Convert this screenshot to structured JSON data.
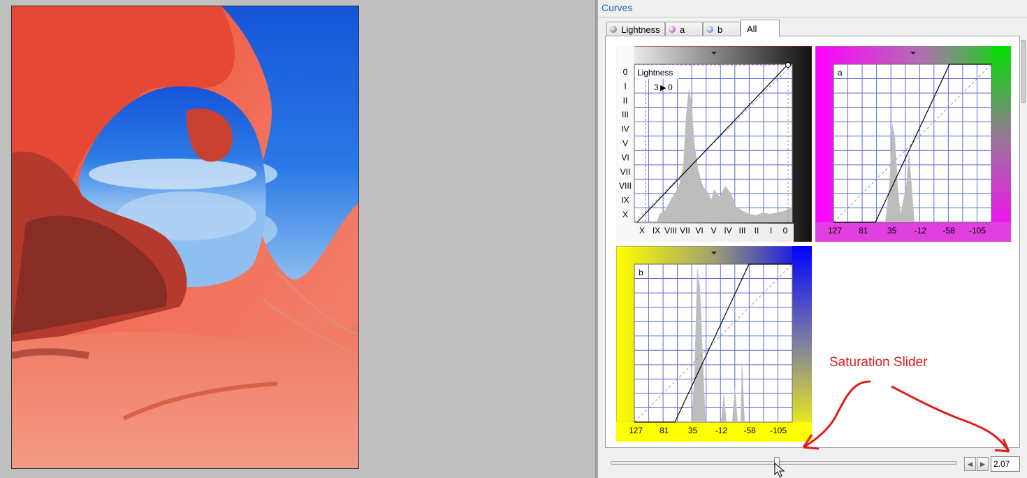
{
  "panel": {
    "title": "Curves"
  },
  "tabs": [
    {
      "label": "Lightness",
      "dot": "#555555"
    },
    {
      "label": "a",
      "dot": "#a030a0"
    },
    {
      "label": "b",
      "dot": "#3070c0"
    },
    {
      "label": "All",
      "dot": ""
    }
  ],
  "lightness_curve": {
    "label": "Lightness",
    "readout_in": "3",
    "readout_arrow": "▶",
    "readout_out": "0",
    "y_axis_ticks": [
      "0",
      "I",
      "II",
      "III",
      "IV",
      "V",
      "VI",
      "VII",
      "VIII",
      "IX",
      "X"
    ],
    "x_axis_ticks": [
      "X",
      "IX",
      "VIII",
      "VII",
      "VI",
      "V",
      "IV",
      "III",
      "II",
      "I",
      "0"
    ]
  },
  "a_curve": {
    "label": "a",
    "x_axis_ticks": [
      "127",
      "81",
      "35",
      "-12",
      "-58",
      "-105"
    ]
  },
  "b_curve": {
    "label": "b",
    "x_axis_ticks": [
      "127",
      "81",
      "35",
      "-12",
      "-58",
      "-105"
    ]
  },
  "saturation": {
    "value": "2.07",
    "slider_fraction": 0.48
  },
  "annotation": {
    "text": "Saturation Slider",
    "color": "#e11b1b"
  },
  "colors": {
    "grid": "#5b6bd8",
    "panel_title": "#2a5db0",
    "a_left": "#ff00ff",
    "a_right": "#00e000",
    "b_left": "#ffff00",
    "b_right": "#0000ff"
  }
}
